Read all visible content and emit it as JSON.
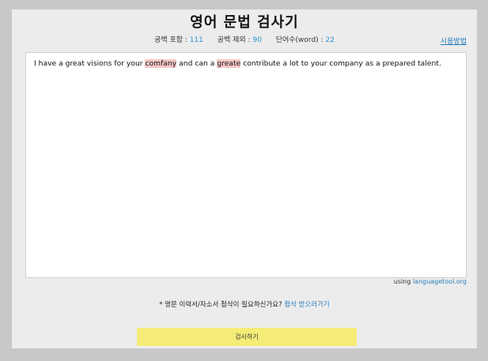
{
  "header": {
    "title": "영어 문법 검사기",
    "how_to_use": "시용방법"
  },
  "counts": {
    "with_spaces_label": "공백 포함 :",
    "with_spaces_value": "111",
    "without_spaces_label": "공백 제외 :",
    "without_spaces_value": "90",
    "words_label": "단어수(word) :",
    "words_value": "22"
  },
  "editor": {
    "segments": [
      "I have a great visions for your ",
      "comfany",
      " and can a ",
      "greate",
      " contribute a lot to your company as a prepared talent."
    ]
  },
  "credit": {
    "prefix": "using",
    "link": "languagetool.org"
  },
  "notice": {
    "text": "* 영문 이력서/자소서 첨삭이 필요하신가요?",
    "link": "첨삭 받으러가기"
  },
  "actions": {
    "check_label": "검사하기"
  },
  "colors": {
    "error_highlight": "#f6c7c7",
    "accent_link": "#2a7fbf",
    "button": "#f5ec78"
  }
}
